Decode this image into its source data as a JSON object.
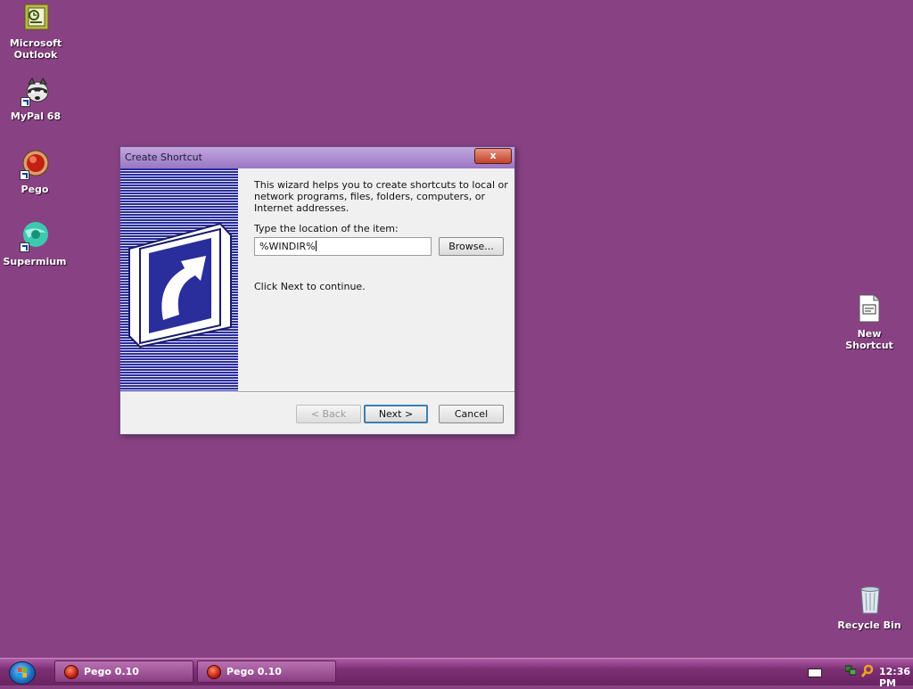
{
  "desktop": {
    "icons": [
      {
        "label": "Microsoft Outlook",
        "icon": "outlook-icon"
      },
      {
        "label": "MyPal 68",
        "icon": "mypal-raccoon-icon"
      },
      {
        "label": "Pego",
        "icon": "pego-red-orb-icon"
      },
      {
        "label": "Supermium",
        "icon": "supermium-icon"
      },
      {
        "label": "New Shortcut",
        "icon": "shortcut-file-icon"
      },
      {
        "label": "Recycle Bin",
        "icon": "recycle-bin-icon"
      }
    ],
    "background_color": "#884283"
  },
  "dialog": {
    "title": "Create Shortcut",
    "close_label": "x",
    "intro_text": "This wizard helps you to create shortcuts to local or network programs, files, folders, computers, or Internet addresses.",
    "location_label": "Type the location of the item:",
    "location_value": "%WINDIR%",
    "browse_label": "Browse...",
    "continue_text": "Click Next to continue.",
    "back_label": "< Back",
    "next_label": "Next >",
    "cancel_label": "Cancel",
    "side_art_color": "#2a2d9c"
  },
  "taskbar": {
    "start_icon": "windows-start-orb",
    "tasks": [
      {
        "label": "Pego 0.10",
        "icon": "pego-red-orb-icon"
      },
      {
        "label": "Pego 0.10",
        "icon": "pego-red-orb-icon"
      }
    ],
    "clock": "12:36 PM"
  }
}
